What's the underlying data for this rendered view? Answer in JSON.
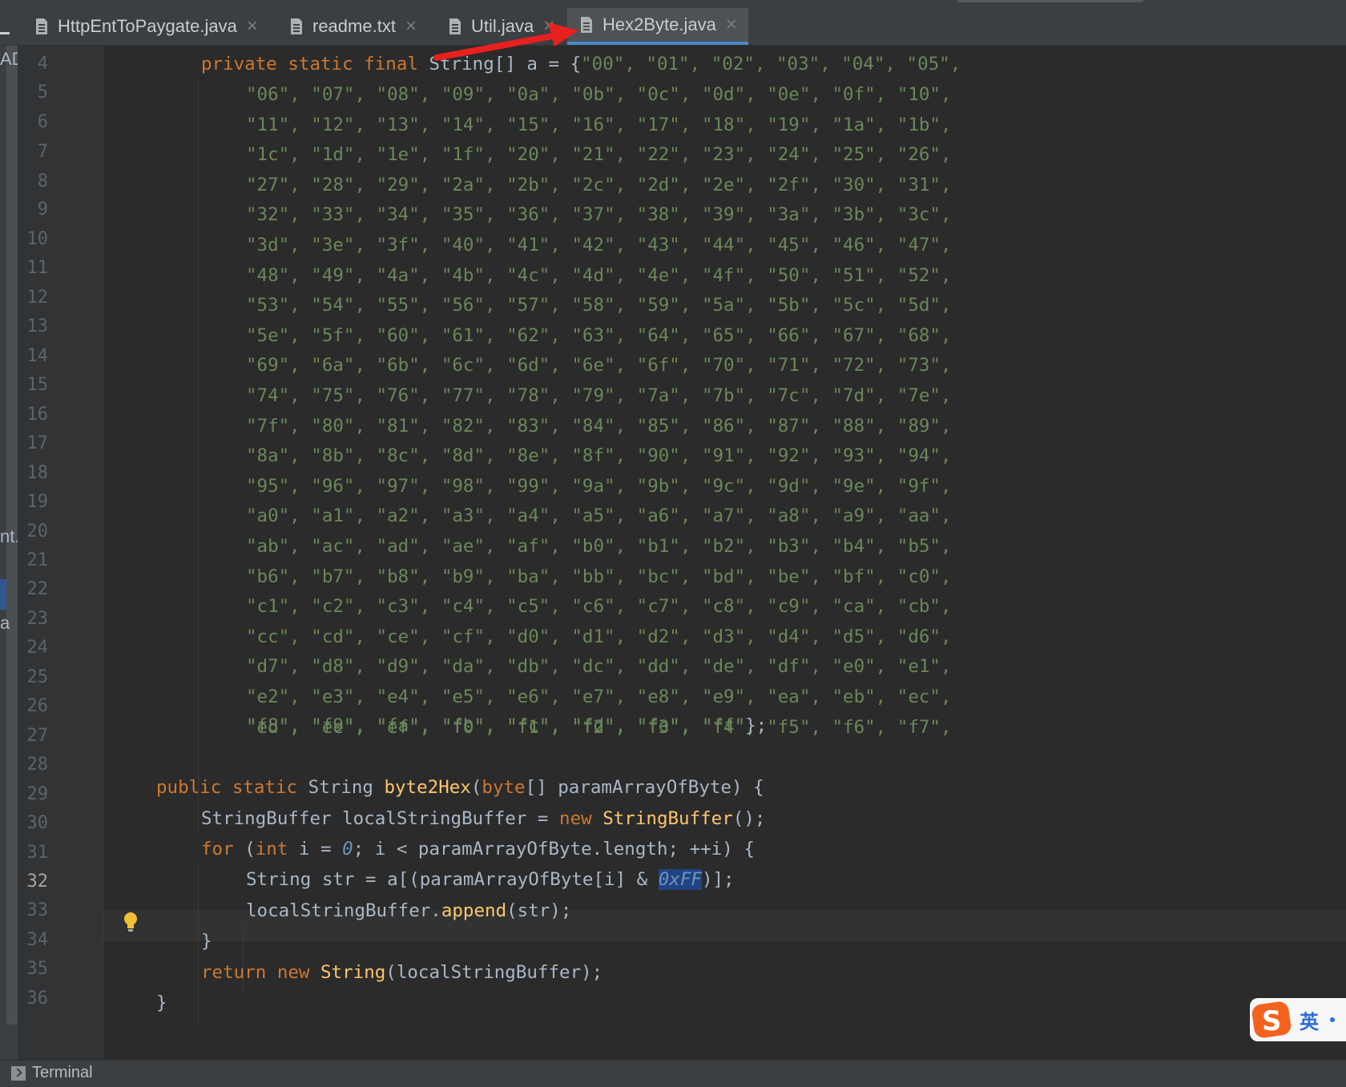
{
  "tabs": [
    {
      "label": "HttpEntToPaygate.java",
      "active": false
    },
    {
      "label": "readme.txt",
      "active": false
    },
    {
      "label": "Util.java",
      "active": false
    },
    {
      "label": "Hex2Byte.java",
      "active": true
    }
  ],
  "close_glyph": "×",
  "left_fragments": {
    "top": "AD",
    "mid": "nt.j",
    "low": "a"
  },
  "line_numbers": [
    "4",
    "5",
    "6",
    "7",
    "8",
    "9",
    "10",
    "11",
    "12",
    "13",
    "14",
    "15",
    "16",
    "17",
    "18",
    "19",
    "20",
    "21",
    "22",
    "23",
    "24",
    "25",
    "26",
    "27",
    "28",
    "29",
    "30",
    "31",
    "32",
    "33",
    "34",
    "35",
    "36"
  ],
  "current_line": "32",
  "code": {
    "l4": {
      "kw": "private static final ",
      "type": "String",
      "rest": "[] a = {",
      "strs": "\"00\", \"01\", \"02\", \"03\", \"04\", \"05\","
    },
    "hex_rows": [
      "\"06\", \"07\", \"08\", \"09\", \"0a\", \"0b\", \"0c\", \"0d\", \"0e\", \"0f\", \"10\",",
      "\"11\", \"12\", \"13\", \"14\", \"15\", \"16\", \"17\", \"18\", \"19\", \"1a\", \"1b\",",
      "\"1c\", \"1d\", \"1e\", \"1f\", \"20\", \"21\", \"22\", \"23\", \"24\", \"25\", \"26\",",
      "\"27\", \"28\", \"29\", \"2a\", \"2b\", \"2c\", \"2d\", \"2e\", \"2f\", \"30\", \"31\",",
      "\"32\", \"33\", \"34\", \"35\", \"36\", \"37\", \"38\", \"39\", \"3a\", \"3b\", \"3c\",",
      "\"3d\", \"3e\", \"3f\", \"40\", \"41\", \"42\", \"43\", \"44\", \"45\", \"46\", \"47\",",
      "\"48\", \"49\", \"4a\", \"4b\", \"4c\", \"4d\", \"4e\", \"4f\", \"50\", \"51\", \"52\",",
      "\"53\", \"54\", \"55\", \"56\", \"57\", \"58\", \"59\", \"5a\", \"5b\", \"5c\", \"5d\",",
      "\"5e\", \"5f\", \"60\", \"61\", \"62\", \"63\", \"64\", \"65\", \"66\", \"67\", \"68\",",
      "\"69\", \"6a\", \"6b\", \"6c\", \"6d\", \"6e\", \"6f\", \"70\", \"71\", \"72\", \"73\",",
      "\"74\", \"75\", \"76\", \"77\", \"78\", \"79\", \"7a\", \"7b\", \"7c\", \"7d\", \"7e\",",
      "\"7f\", \"80\", \"81\", \"82\", \"83\", \"84\", \"85\", \"86\", \"87\", \"88\", \"89\",",
      "\"8a\", \"8b\", \"8c\", \"8d\", \"8e\", \"8f\", \"90\", \"91\", \"92\", \"93\", \"94\",",
      "\"95\", \"96\", \"97\", \"98\", \"99\", \"9a\", \"9b\", \"9c\", \"9d\", \"9e\", \"9f\",",
      "\"a0\", \"a1\", \"a2\", \"a3\", \"a4\", \"a5\", \"a6\", \"a7\", \"a8\", \"a9\", \"aa\",",
      "\"ab\", \"ac\", \"ad\", \"ae\", \"af\", \"b0\", \"b1\", \"b2\", \"b3\", \"b4\", \"b5\",",
      "\"b6\", \"b7\", \"b8\", \"b9\", \"ba\", \"bb\", \"bc\", \"bd\", \"be\", \"bf\", \"c0\",",
      "\"c1\", \"c2\", \"c3\", \"c4\", \"c5\", \"c6\", \"c7\", \"c8\", \"c9\", \"ca\", \"cb\",",
      "\"cc\", \"cd\", \"ce\", \"cf\", \"d0\", \"d1\", \"d2\", \"d3\", \"d4\", \"d5\", \"d6\",",
      "\"d7\", \"d8\", \"d9\", \"da\", \"db\", \"dc\", \"dd\", \"de\", \"df\", \"e0\", \"e1\",",
      "\"e2\", \"e3\", \"e4\", \"e5\", \"e6\", \"e7\", \"e8\", \"e9\", \"ea\", \"eb\", \"ec\",",
      "\"ed\", \"ee\", \"ef\", \"f0\", \"f1\", \"f2\", \"f3\", \"f4\", \"f5\", \"f6\", \"f7\","
    ],
    "l27": {
      "strs": "\"f8\", \"f9\", \"fa\", \"fb\", \"fc\", \"fd\", \"fe\", \"ff\"",
      "end": "};"
    },
    "l29": {
      "kw": "public static ",
      "type": "String ",
      "fn": "byte2Hex",
      "p1": "(",
      "kw2": "byte",
      "rest": "[] paramArrayOfByte) {"
    },
    "l30": {
      "a": "StringBuffer localStringBuffer = ",
      "kw": "new ",
      "fn": "StringBuffer",
      "b": "();"
    },
    "l31": {
      "kw": "for ",
      "a": "(",
      "kw2": "int ",
      "b": "i = ",
      "num": "0",
      "c": "; i < paramArrayOfByte.length; ++i) {"
    },
    "l32": {
      "a": "String str = a[(paramArrayOfByte[i] & ",
      "num": "0xFF",
      "b": ")];"
    },
    "l33": {
      "a": "localStringBuffer.",
      "fn": "append",
      "b": "(str);"
    },
    "l34": "}",
    "l35": {
      "kw": "return new ",
      "fn": "String",
      "b": "(localStringBuffer);"
    },
    "l36": "}"
  },
  "status": {
    "terminal_label": "Terminal"
  },
  "ime": {
    "lang": "英"
  },
  "colors": {
    "keyword": "#cc7832",
    "string": "#6a8759",
    "function": "#ffc66d",
    "number": "#6897bb",
    "annotation_arrow": "#e8201f"
  }
}
